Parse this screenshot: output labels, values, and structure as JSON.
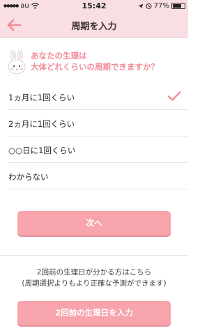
{
  "status": {
    "carrier": "au",
    "time": "15:42",
    "battery": "77%",
    "battery_level": 0.77
  },
  "nav": {
    "title": "周期を入力"
  },
  "question": {
    "line1": "あなたの生理は",
    "line2": "大体どれくらいの周期できますか？"
  },
  "options": [
    {
      "label": "1ヵ月に1回くらい",
      "selected": true
    },
    {
      "label": "2ヵ月に1回くらい",
      "selected": false
    },
    {
      "label": "○○日に1回くらい",
      "selected": false
    },
    {
      "label": "わからない",
      "selected": false
    }
  ],
  "next_label": "次へ",
  "info": {
    "line1": "2回前の生理日が分かる方はこちら",
    "line2": "(周期選択よりもより正確な予測ができます)"
  },
  "prev_button_label": "2回前の生理日を入力",
  "colors": {
    "accent": "#f28a97",
    "button": "#f7a4ac",
    "header": "#f9dfe3"
  }
}
